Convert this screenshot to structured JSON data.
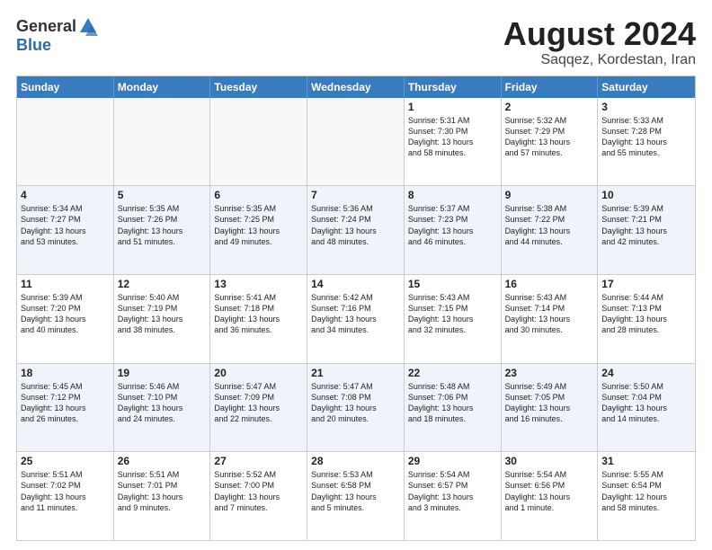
{
  "logo": {
    "general": "General",
    "blue": "Blue"
  },
  "title": {
    "month_year": "August 2024",
    "location": "Saqqez, Kordestan, Iran"
  },
  "header_days": [
    "Sunday",
    "Monday",
    "Tuesday",
    "Wednesday",
    "Thursday",
    "Friday",
    "Saturday"
  ],
  "weeks": [
    {
      "alt": false,
      "cells": [
        {
          "day": "",
          "info": ""
        },
        {
          "day": "",
          "info": ""
        },
        {
          "day": "",
          "info": ""
        },
        {
          "day": "",
          "info": ""
        },
        {
          "day": "1",
          "info": "Sunrise: 5:31 AM\nSunset: 7:30 PM\nDaylight: 13 hours\nand 58 minutes."
        },
        {
          "day": "2",
          "info": "Sunrise: 5:32 AM\nSunset: 7:29 PM\nDaylight: 13 hours\nand 57 minutes."
        },
        {
          "day": "3",
          "info": "Sunrise: 5:33 AM\nSunset: 7:28 PM\nDaylight: 13 hours\nand 55 minutes."
        }
      ]
    },
    {
      "alt": true,
      "cells": [
        {
          "day": "4",
          "info": "Sunrise: 5:34 AM\nSunset: 7:27 PM\nDaylight: 13 hours\nand 53 minutes."
        },
        {
          "day": "5",
          "info": "Sunrise: 5:35 AM\nSunset: 7:26 PM\nDaylight: 13 hours\nand 51 minutes."
        },
        {
          "day": "6",
          "info": "Sunrise: 5:35 AM\nSunset: 7:25 PM\nDaylight: 13 hours\nand 49 minutes."
        },
        {
          "day": "7",
          "info": "Sunrise: 5:36 AM\nSunset: 7:24 PM\nDaylight: 13 hours\nand 48 minutes."
        },
        {
          "day": "8",
          "info": "Sunrise: 5:37 AM\nSunset: 7:23 PM\nDaylight: 13 hours\nand 46 minutes."
        },
        {
          "day": "9",
          "info": "Sunrise: 5:38 AM\nSunset: 7:22 PM\nDaylight: 13 hours\nand 44 minutes."
        },
        {
          "day": "10",
          "info": "Sunrise: 5:39 AM\nSunset: 7:21 PM\nDaylight: 13 hours\nand 42 minutes."
        }
      ]
    },
    {
      "alt": false,
      "cells": [
        {
          "day": "11",
          "info": "Sunrise: 5:39 AM\nSunset: 7:20 PM\nDaylight: 13 hours\nand 40 minutes."
        },
        {
          "day": "12",
          "info": "Sunrise: 5:40 AM\nSunset: 7:19 PM\nDaylight: 13 hours\nand 38 minutes."
        },
        {
          "day": "13",
          "info": "Sunrise: 5:41 AM\nSunset: 7:18 PM\nDaylight: 13 hours\nand 36 minutes."
        },
        {
          "day": "14",
          "info": "Sunrise: 5:42 AM\nSunset: 7:16 PM\nDaylight: 13 hours\nand 34 minutes."
        },
        {
          "day": "15",
          "info": "Sunrise: 5:43 AM\nSunset: 7:15 PM\nDaylight: 13 hours\nand 32 minutes."
        },
        {
          "day": "16",
          "info": "Sunrise: 5:43 AM\nSunset: 7:14 PM\nDaylight: 13 hours\nand 30 minutes."
        },
        {
          "day": "17",
          "info": "Sunrise: 5:44 AM\nSunset: 7:13 PM\nDaylight: 13 hours\nand 28 minutes."
        }
      ]
    },
    {
      "alt": true,
      "cells": [
        {
          "day": "18",
          "info": "Sunrise: 5:45 AM\nSunset: 7:12 PM\nDaylight: 13 hours\nand 26 minutes."
        },
        {
          "day": "19",
          "info": "Sunrise: 5:46 AM\nSunset: 7:10 PM\nDaylight: 13 hours\nand 24 minutes."
        },
        {
          "day": "20",
          "info": "Sunrise: 5:47 AM\nSunset: 7:09 PM\nDaylight: 13 hours\nand 22 minutes."
        },
        {
          "day": "21",
          "info": "Sunrise: 5:47 AM\nSunset: 7:08 PM\nDaylight: 13 hours\nand 20 minutes."
        },
        {
          "day": "22",
          "info": "Sunrise: 5:48 AM\nSunset: 7:06 PM\nDaylight: 13 hours\nand 18 minutes."
        },
        {
          "day": "23",
          "info": "Sunrise: 5:49 AM\nSunset: 7:05 PM\nDaylight: 13 hours\nand 16 minutes."
        },
        {
          "day": "24",
          "info": "Sunrise: 5:50 AM\nSunset: 7:04 PM\nDaylight: 13 hours\nand 14 minutes."
        }
      ]
    },
    {
      "alt": false,
      "cells": [
        {
          "day": "25",
          "info": "Sunrise: 5:51 AM\nSunset: 7:02 PM\nDaylight: 13 hours\nand 11 minutes."
        },
        {
          "day": "26",
          "info": "Sunrise: 5:51 AM\nSunset: 7:01 PM\nDaylight: 13 hours\nand 9 minutes."
        },
        {
          "day": "27",
          "info": "Sunrise: 5:52 AM\nSunset: 7:00 PM\nDaylight: 13 hours\nand 7 minutes."
        },
        {
          "day": "28",
          "info": "Sunrise: 5:53 AM\nSunset: 6:58 PM\nDaylight: 13 hours\nand 5 minutes."
        },
        {
          "day": "29",
          "info": "Sunrise: 5:54 AM\nSunset: 6:57 PM\nDaylight: 13 hours\nand 3 minutes."
        },
        {
          "day": "30",
          "info": "Sunrise: 5:54 AM\nSunset: 6:56 PM\nDaylight: 13 hours\nand 1 minute."
        },
        {
          "day": "31",
          "info": "Sunrise: 5:55 AM\nSunset: 6:54 PM\nDaylight: 12 hours\nand 58 minutes."
        }
      ]
    }
  ]
}
